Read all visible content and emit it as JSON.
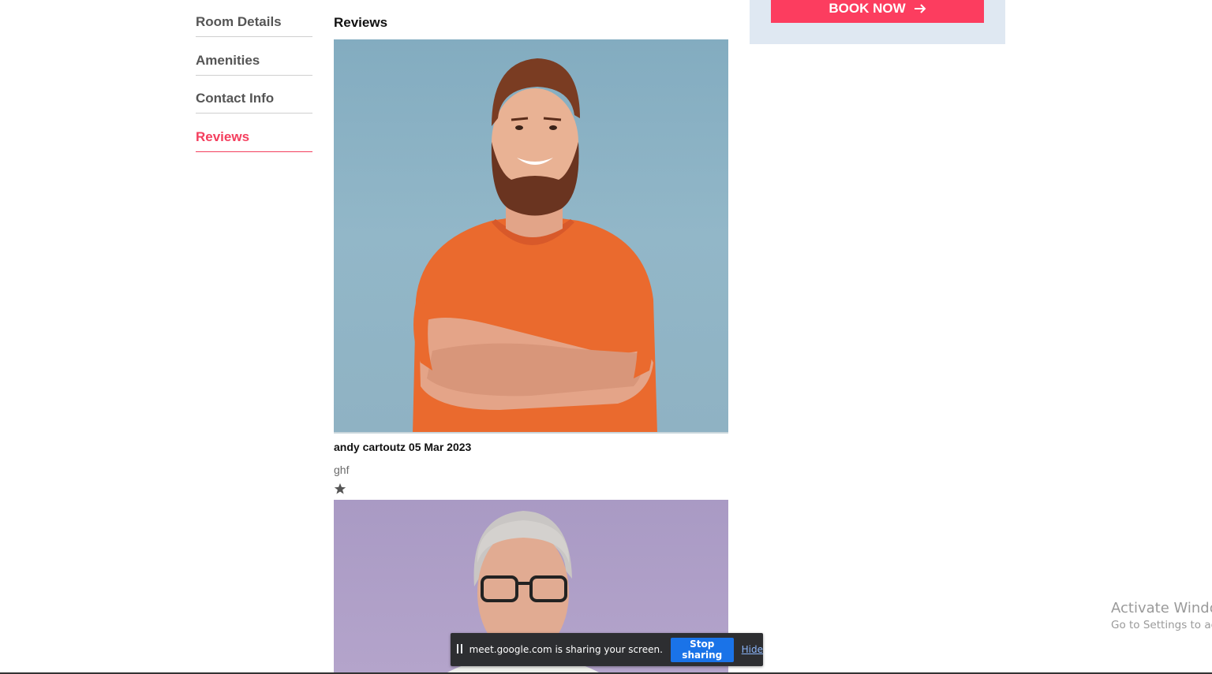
{
  "side_nav": {
    "items": [
      {
        "label": "Room Details",
        "active": false
      },
      {
        "label": "Amenities",
        "active": false
      },
      {
        "label": "Contact Info",
        "active": false
      },
      {
        "label": "Reviews",
        "active": true
      }
    ],
    "active_color": "#f43f5e"
  },
  "reviews": {
    "title": "Reviews",
    "items": [
      {
        "author_date": "andy cartoutz 05 Mar 2023",
        "text": "ghf",
        "rating": 1
      }
    ]
  },
  "booking": {
    "button_label": "BOOK NOW",
    "button_icon": "arrow-right-icon",
    "button_color": "#fc3d5f"
  },
  "watermark": {
    "line1": "Activate Windo",
    "line2": "Go to Settings to ac"
  },
  "share_bar": {
    "message": "meet.google.com is sharing your screen.",
    "stop_label": "Stop sharing",
    "hide_label": "Hide"
  }
}
